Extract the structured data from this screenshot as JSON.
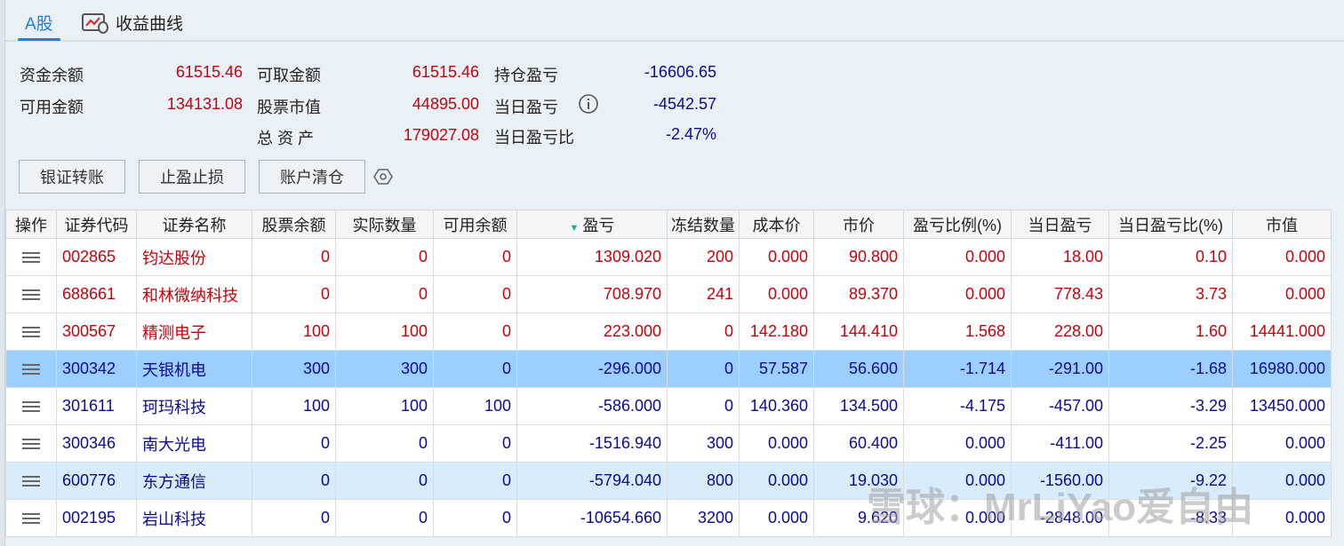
{
  "tabs": [
    {
      "label": "A股"
    },
    {
      "label": "收益曲线"
    }
  ],
  "summary": {
    "fund_balance_label": "资金余额",
    "fund_balance": "61515.46",
    "available_label": "可用金额",
    "available": "134131.08",
    "withdrawable_label": "可取金额",
    "withdrawable": "61515.46",
    "market_value_label": "股票市值",
    "market_value": "44895.00",
    "total_assets_label": "总 资 产",
    "total_assets": "179027.08",
    "position_pl_label": "持仓盈亏",
    "position_pl": "-16606.65",
    "daily_pl_label": "当日盈亏",
    "daily_pl": "-4542.57",
    "daily_pl_ratio_label": "当日盈亏比",
    "daily_pl_ratio": "-2.47%"
  },
  "buttons": {
    "transfer": "银证转账",
    "stop": "止盈止损",
    "clear": "账户清仓"
  },
  "columns": [
    "操作",
    "证券代码",
    "证券名称",
    "股票余额",
    "实际数量",
    "可用余额",
    "盈亏",
    "冻结数量",
    "成本价",
    "市价",
    "盈亏比例(%)",
    "当日盈亏",
    "当日盈亏比(%)",
    "市值"
  ],
  "rows": [
    {
      "color": "red",
      "cells": [
        "002865",
        "钧达股份",
        "0",
        "0",
        "0",
        "1309.020",
        "200",
        "0.000",
        "90.800",
        "0.000",
        "18.00",
        "0.10",
        "0.000"
      ]
    },
    {
      "color": "red",
      "cells": [
        "688661",
        "和林微纳科技",
        "0",
        "0",
        "0",
        "708.970",
        "241",
        "0.000",
        "89.370",
        "0.000",
        "778.43",
        "3.73",
        "0.000"
      ]
    },
    {
      "color": "red",
      "cells": [
        "300567",
        "精测电子",
        "100",
        "100",
        "0",
        "223.000",
        "0",
        "142.180",
        "144.410",
        "1.568",
        "228.00",
        "1.60",
        "14441.000"
      ]
    },
    {
      "color": "blue",
      "state": "sel",
      "cells": [
        "300342",
        "天银机电",
        "300",
        "300",
        "0",
        "-296.000",
        "0",
        "57.587",
        "56.600",
        "-1.714",
        "-291.00",
        "-1.68",
        "16980.000"
      ]
    },
    {
      "color": "blue",
      "cells": [
        "301611",
        "珂玛科技",
        "100",
        "100",
        "100",
        "-586.000",
        "0",
        "140.360",
        "134.500",
        "-4.175",
        "-457.00",
        "-3.29",
        "13450.000"
      ]
    },
    {
      "color": "blue",
      "cells": [
        "300346",
        "南大光电",
        "0",
        "0",
        "0",
        "-1516.940",
        "300",
        "0.000",
        "60.400",
        "0.000",
        "-411.00",
        "-2.25",
        "0.000"
      ]
    },
    {
      "color": "blue",
      "state": "alt",
      "cells": [
        "600776",
        "东方通信",
        "0",
        "0",
        "0",
        "-5794.040",
        "800",
        "0.000",
        "19.030",
        "0.000",
        "-1560.00",
        "-9.22",
        "0.000"
      ]
    },
    {
      "color": "blue",
      "cells": [
        "002195",
        "岩山科技",
        "0",
        "0",
        "0",
        "-10654.660",
        "3200",
        "0.000",
        "9.620",
        "0.000",
        "-2848.00",
        "-8.33",
        "0.000"
      ]
    }
  ],
  "watermark": "雪球：MrLiYao爱自由"
}
